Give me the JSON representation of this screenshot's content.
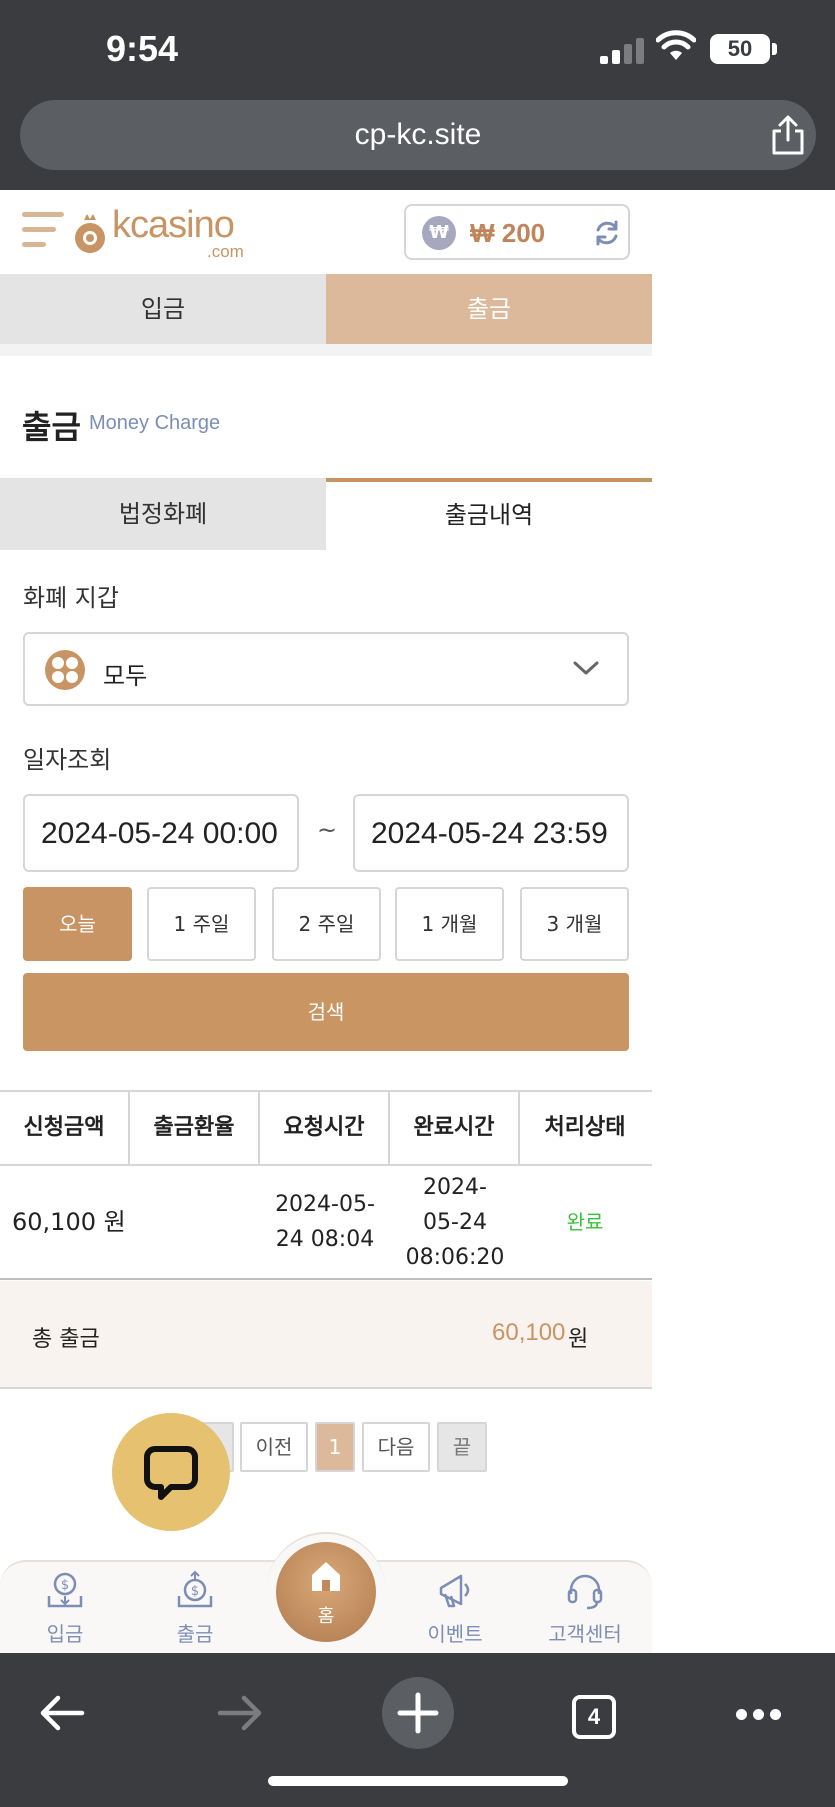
{
  "status_bar": {
    "time": "9:54",
    "battery": "50"
  },
  "browser": {
    "url": "cp-kc.site",
    "tab_count": "4"
  },
  "header": {
    "logo_text": "kcasino",
    "logo_sub": ".com",
    "won_symbol": "₩",
    "balance": "₩ 200"
  },
  "main_tabs": {
    "deposit": "입금",
    "withdraw": "출금"
  },
  "section": {
    "title": "출금",
    "subtitle": "Money Charge"
  },
  "sub_tabs": {
    "fiat": "법정화폐",
    "history": "출금내역"
  },
  "wallet": {
    "label": "화폐 지갑",
    "selected": "모두"
  },
  "date": {
    "label": "일자조회",
    "from": "2024-05-24 00:00",
    "to": "2024-05-24 23:59",
    "separator": "~"
  },
  "range_buttons": [
    "오늘",
    "1 주일",
    "2 주일",
    "1 개월",
    "3 개월"
  ],
  "search_label": "검색",
  "table": {
    "headers": [
      "신청금액",
      "출금환율",
      "요청시간",
      "완료시간",
      "처리상태"
    ],
    "rows": [
      {
        "amount": "60,100 원",
        "rate": "",
        "requested": "2024-05-24 08:04",
        "completed": "2024-05-24 08:06:20",
        "status": "완료"
      }
    ]
  },
  "total": {
    "label": "총 출금",
    "value": "60,100",
    "unit": "원"
  },
  "pager": {
    "prev": "이전",
    "current": "1",
    "next": "다음",
    "last": "끝"
  },
  "bottom_nav": {
    "deposit": "입금",
    "withdraw": "출금",
    "home": "홈",
    "event": "이벤트",
    "support": "고객센터"
  },
  "colors": {
    "accent": "#c89464",
    "tab_active": "#dcb99a",
    "status_done": "#3cc03c",
    "nav_label": "#7c8eb5"
  }
}
